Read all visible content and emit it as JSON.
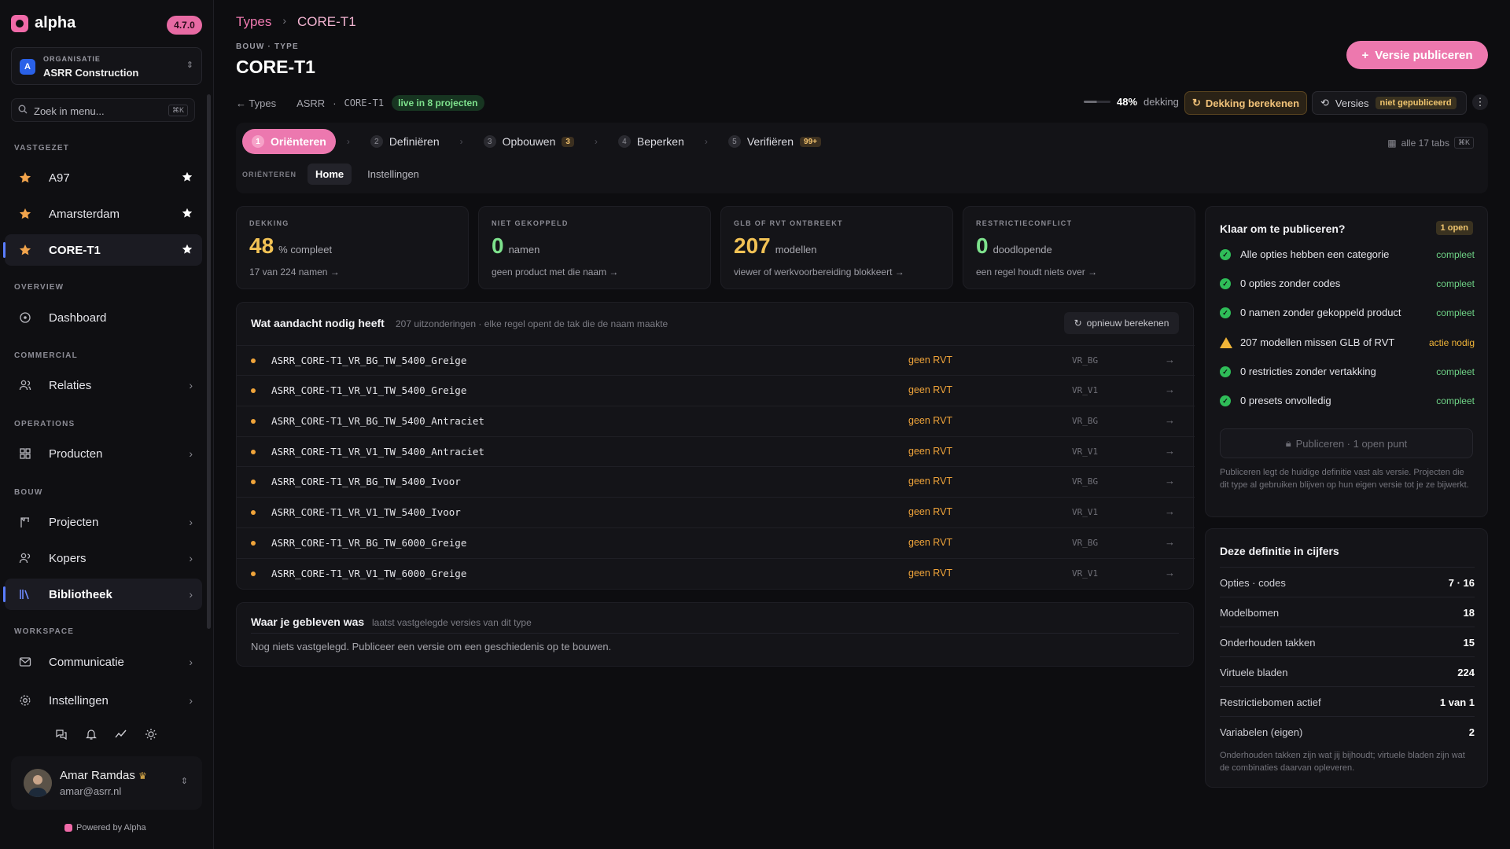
{
  "app": {
    "name": "alpha",
    "version": "4.7.0"
  },
  "organization": {
    "label": "ORGANISATIE",
    "name": "ASRR Construction",
    "initial": "A"
  },
  "search": {
    "placeholder": "Zoek in menu...",
    "shortcut": "⌘K"
  },
  "sidebar": {
    "pinned_label": "VASTGEZET",
    "pinned": [
      {
        "label": "A97"
      },
      {
        "label": "Amarsterdam"
      },
      {
        "label": "CORE-T1"
      }
    ],
    "overview_label": "OVERVIEW",
    "dashboard": "Dashboard",
    "commercial_label": "COMMERCIAL",
    "relaties": "Relaties",
    "operations_label": "OPERATIONS",
    "producten": "Producten",
    "bouw_label": "BOUW",
    "projecten": "Projecten",
    "kopers": "Kopers",
    "bibliotheek": "Bibliotheek",
    "workspace_label": "WORKSPACE",
    "communicatie": "Communicatie",
    "instellingen": "Instellingen"
  },
  "user": {
    "name": "Amar Ramdas",
    "email": "amar@asrr.nl"
  },
  "footer": {
    "powered": "Powered by Alpha"
  },
  "breadcrumb": {
    "parent": "Types",
    "current": "CORE-T1"
  },
  "page": {
    "eyebrow": "BOUW · TYPE",
    "title": "CORE-T1",
    "publish_button": "Versie publiceren"
  },
  "meta": {
    "back": "Types",
    "org": "ASRR",
    "type": "CORE-T1",
    "live": "live in 8 projecten"
  },
  "coverage": {
    "percent": "48%",
    "label": "dekking",
    "value": 0.48
  },
  "calc_button": "Dekking berekenen",
  "versions": {
    "label": "Versies",
    "status": "niet gepubliceerd"
  },
  "steps": [
    {
      "num": "1",
      "label": "Oriënteren",
      "active": true
    },
    {
      "num": "2",
      "label": "Definiëren"
    },
    {
      "num": "3",
      "label": "Opbouwen",
      "badge": "3"
    },
    {
      "num": "4",
      "label": "Beperken"
    },
    {
      "num": "5",
      "label": "Verifiëren",
      "badge": "99+"
    }
  ],
  "all_tabs": {
    "label": "alle 17 tabs",
    "shortcut": "⌘K"
  },
  "subtabs": {
    "eyebrow": "ORIËNTEREN",
    "home": "Home",
    "settings": "Instellingen"
  },
  "stats": [
    {
      "label": "DEKKING",
      "value": "48",
      "unit": "% compleet",
      "sub": "17 van 224 namen →",
      "color": "#f2c255"
    },
    {
      "label": "NIET GEKOPPELD",
      "value": "0",
      "unit": "namen",
      "sub": "geen product met die naam →",
      "color": "#7ee28d"
    },
    {
      "label": "GLB OF RVT ONTBREEKT",
      "value": "207",
      "unit": "modellen",
      "sub": "viewer of werkvoorbereiding blokkeert →",
      "color": "#f2c255"
    },
    {
      "label": "RESTRICTIECONFLICT",
      "value": "0",
      "unit": "doodlopende",
      "sub": "een regel houdt niets over →",
      "color": "#7ee28d"
    }
  ],
  "attention": {
    "title": "Wat aandacht nodig heeft",
    "subtitle": "207 uitzonderingen · elke regel opent de tak die de naam maakte",
    "recalc": "opnieuw berekenen",
    "rows": [
      {
        "name": "ASRR_CORE-T1_VR_BG_TW_5400_Greige",
        "status": "geen RVT",
        "code": "VR_BG"
      },
      {
        "name": "ASRR_CORE-T1_VR_V1_TW_5400_Greige",
        "status": "geen RVT",
        "code": "VR_V1"
      },
      {
        "name": "ASRR_CORE-T1_VR_BG_TW_5400_Antraciet",
        "status": "geen RVT",
        "code": "VR_BG"
      },
      {
        "name": "ASRR_CORE-T1_VR_V1_TW_5400_Antraciet",
        "status": "geen RVT",
        "code": "VR_V1"
      },
      {
        "name": "ASRR_CORE-T1_VR_BG_TW_5400_Ivoor",
        "status": "geen RVT",
        "code": "VR_BG"
      },
      {
        "name": "ASRR_CORE-T1_VR_V1_TW_5400_Ivoor",
        "status": "geen RVT",
        "code": "VR_V1"
      },
      {
        "name": "ASRR_CORE-T1_VR_BG_TW_6000_Greige",
        "status": "geen RVT",
        "code": "VR_BG"
      },
      {
        "name": "ASRR_CORE-T1_VR_V1_TW_6000_Greige",
        "status": "geen RVT",
        "code": "VR_V1"
      }
    ]
  },
  "where": {
    "title": "Waar je gebleven was",
    "subtitle": "laatst vastgelegde versies van dit type",
    "text": "Nog niets vastgelegd. Publiceer een versie om een geschiedenis op te bouwen."
  },
  "ready": {
    "title": "Klaar om te publiceren?",
    "badge": "1 open",
    "checks": [
      {
        "text": "Alle opties hebben een categorie",
        "state": "compleet",
        "warn": false
      },
      {
        "text": "0 opties zonder codes",
        "state": "compleet",
        "warn": false
      },
      {
        "text": "0 namen zonder gekoppeld product",
        "state": "compleet",
        "warn": false
      },
      {
        "text": "207 modellen missen GLB of RVT",
        "state": "actie nodig",
        "warn": true
      },
      {
        "text": "0 restricties zonder vertakking",
        "state": "compleet",
        "warn": false
      },
      {
        "text": "0 presets onvolledig",
        "state": "compleet",
        "warn": false
      }
    ],
    "button": "Publiceren · 1 open punt",
    "note": "Publiceren legt de huidige definitie vast als versie. Projecten die dit type al gebruiken blijven op hun eigen versie tot je ze bijwerkt."
  },
  "figures": {
    "title": "Deze definitie in cijfers",
    "rows": [
      {
        "label": "Opties · codes",
        "value": "7 · 16"
      },
      {
        "label": "Modelbomen",
        "value": "18"
      },
      {
        "label": "Onderhouden takken",
        "value": "15"
      },
      {
        "label": "Virtuele bladen",
        "value": "224"
      },
      {
        "label": "Restrictiebomen actief",
        "value": "1 van 1"
      },
      {
        "label": "Variabelen (eigen)",
        "value": "2"
      }
    ],
    "note": "Onderhouden takken zijn wat jij bijhoudt; virtuele bladen zijn wat de combinaties daarvan opleveren."
  }
}
